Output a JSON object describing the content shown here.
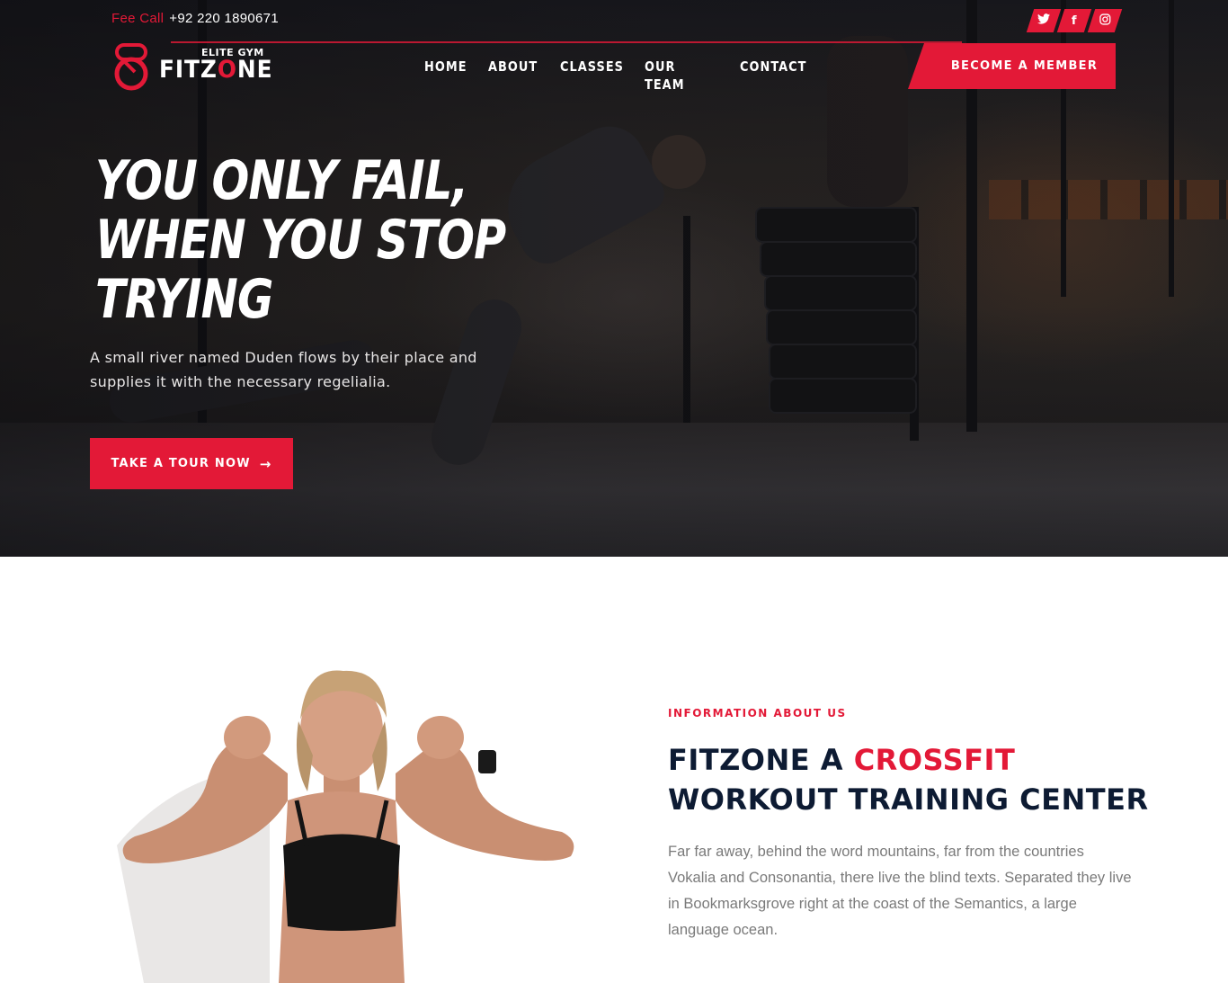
{
  "topbar": {
    "call_label": "Fee Call",
    "phone": "+92 220 1890671",
    "socials": [
      {
        "name": "twitter-icon",
        "glyph": "🐦"
      },
      {
        "name": "facebook-icon",
        "glyph": "f"
      },
      {
        "name": "instagram-icon",
        "glyph": "◎"
      }
    ]
  },
  "logo": {
    "tagline": "ELITE GYM",
    "name_part1": "FITZ",
    "name_o": "O",
    "name_part2": "NE"
  },
  "nav": {
    "items": [
      "HOME",
      "ABOUT",
      "CLASSES",
      "OUR TEAM",
      "CONTACT"
    ]
  },
  "cta": {
    "member_label": "BECOME A MEMBER"
  },
  "hero": {
    "headline_1": "YOU ONLY FAIL,",
    "headline_2": "WHEN YOU STOP",
    "headline_3": "TRYING",
    "subtext": "A small river named Duden flows by their place and supplies it with the necessary regelialia.",
    "tour_label": "TAKE A TOUR NOW",
    "tour_arrow": "→"
  },
  "about": {
    "eyebrow": "INFORMATION ABOUT US",
    "title_1": "FITZONE A ",
    "title_red": "CROSSFIT",
    "title_2": "WORKOUT TRAINING CENTER",
    "text": "Far far away, behind the word mountains, far from the countries Vokalia and Consonantia, there live the blind texts. Separated they live in Bookmarksgrove right at the coast of the Semantics, a large language ocean."
  },
  "colors": {
    "accent": "#e31937",
    "navy": "#0d1b33",
    "body_text": "#7a7a7a"
  }
}
